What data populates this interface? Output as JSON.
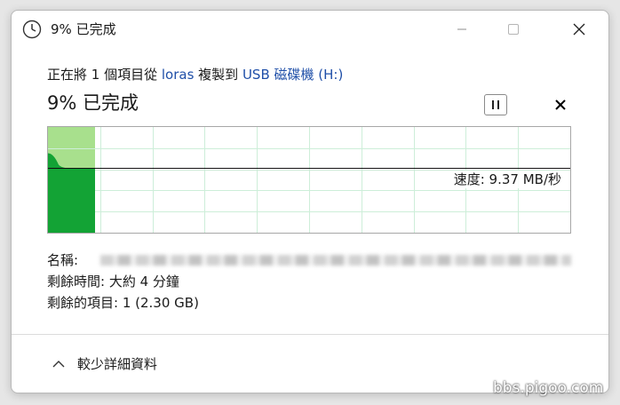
{
  "window": {
    "title": "9% 已完成",
    "icon": "clock-icon"
  },
  "copy": {
    "prefix": "正在將 1 個項目從 ",
    "source": "loras",
    "middle": " 複製到 ",
    "destination": "USB 磁碟機 (H:)",
    "status": "9% 已完成",
    "progress_fraction": 0.09
  },
  "graph": {
    "speed_label": "速度: 9.37 MB/秒",
    "current_speed_fraction": 0.61
  },
  "details": {
    "name_label": "名稱: ",
    "remaining_time_label": "剩餘時間: ",
    "remaining_time_value": "大約 4 分鐘",
    "remaining_items_label": "剩餘的項目: ",
    "remaining_items_value": "1 (2.30 GB)"
  },
  "footer": {
    "toggle_label": "較少詳細資料"
  },
  "watermark": "bbs.pigoo.com",
  "colors": {
    "progress_fill": "#a8e08d",
    "speed_fill": "#13a335",
    "link": "#1f4fa8"
  }
}
